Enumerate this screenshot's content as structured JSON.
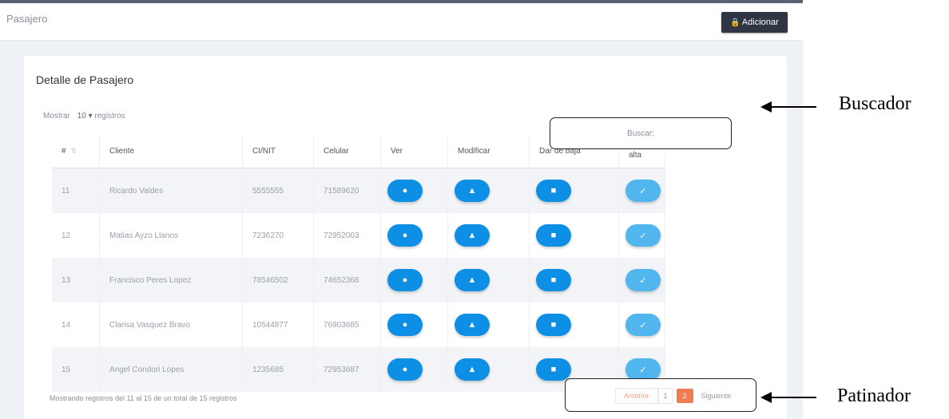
{
  "header": {
    "title": "Pasajero",
    "add_button": "Adicionar",
    "add_icon": "lock-icon"
  },
  "card": {
    "title": "Detalle de Pasajero",
    "show_label": "Mostrar",
    "show_value": "10",
    "show_suffix": "registros",
    "search_placeholder": "Buscar:"
  },
  "table": {
    "columns": [
      "#",
      "Cliente",
      "CI/NIT",
      "Celular",
      "Ver",
      "Modificar",
      "Dar de baja",
      "Dar de alta"
    ],
    "rows": [
      {
        "id": "11",
        "cliente": "Ricardo Valdes",
        "ci": "5555555",
        "celular": "71589620"
      },
      {
        "id": "12",
        "cliente": "Matias Ayzo Llanos",
        "ci": "7236270",
        "celular": "72952003"
      },
      {
        "id": "13",
        "cliente": "Francisco Peres Lopez",
        "ci": "78546502",
        "celular": "74652368"
      },
      {
        "id": "14",
        "cliente": "Clarisa Vasquez Bravo",
        "ci": "10544877",
        "celular": "76903685"
      },
      {
        "id": "15",
        "cliente": "Angel Condori Lopes",
        "ci": "1235685",
        "celular": "72953687"
      }
    ]
  },
  "footer": {
    "info": "Mostrando registros del 11 al 15 de un total de 15 registros",
    "prev": "Anterior",
    "page_one": "1",
    "current": "2",
    "next": "Siguiente"
  },
  "annotations": {
    "search": "Buscador",
    "pager": "Patinador"
  },
  "colors": {
    "primary": "#0d8fe6",
    "light": "#52b6ee",
    "accent": "#f07c52",
    "dark": "#2f3542"
  }
}
